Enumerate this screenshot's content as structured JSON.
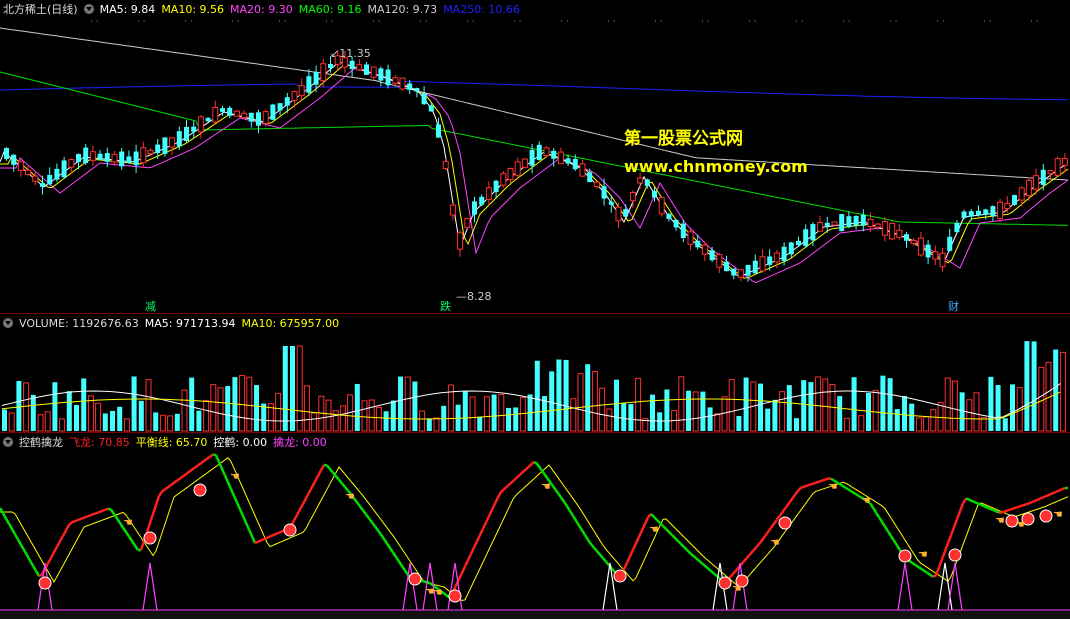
{
  "main": {
    "title": "北方稀土(日线)",
    "indicators": [
      {
        "label": "MA5: 9.84",
        "color": "#ffffff"
      },
      {
        "label": "MA10: 9.56",
        "color": "#ffff00"
      },
      {
        "label": "MA20: 9.30",
        "color": "#ff44ff"
      },
      {
        "label": "MA60: 9.16",
        "color": "#00ff00"
      },
      {
        "label": "MA120: 9.73",
        "color": "#cccccc"
      },
      {
        "label": "MA250: 10.66",
        "color": "#2020ff"
      }
    ],
    "high_label": "11.35",
    "low_label": "8.28",
    "markers": [
      {
        "text": "减",
        "color": "#00ff66"
      },
      {
        "text": "跌",
        "color": "#00ff66"
      },
      {
        "text": "财",
        "color": "#44aaff"
      }
    ]
  },
  "watermark": {
    "line1": "第一股票公式网",
    "line2": "www.chnmoney.com"
  },
  "volume": {
    "label": "VOLUME: 1192676.63",
    "ma5": "MA5: 971713.94",
    "ma10": "MA10: 675957.00"
  },
  "indicator": {
    "name": "控鹤擒龙",
    "items": [
      {
        "label": "飞龙: 70.85",
        "color": "#ff2020"
      },
      {
        "label": "平衡线: 65.70",
        "color": "#ffff00"
      },
      {
        "label": "控鹤: 0.00",
        "color": "#ffffff"
      },
      {
        "label": "擒龙: 0.00",
        "color": "#ff44ff"
      }
    ]
  },
  "colors": {
    "up": "#ff3030",
    "down": "#44ffff",
    "ma5": "#ffffff",
    "ma10": "#ffff00",
    "ma20": "#ff44ff",
    "ma60": "#00dd00",
    "ma120": "#cccccc",
    "ma250": "#2020ff"
  },
  "icons": [
    "collapse-icon",
    "red-ball-icon",
    "hand-pointer-icon"
  ]
}
